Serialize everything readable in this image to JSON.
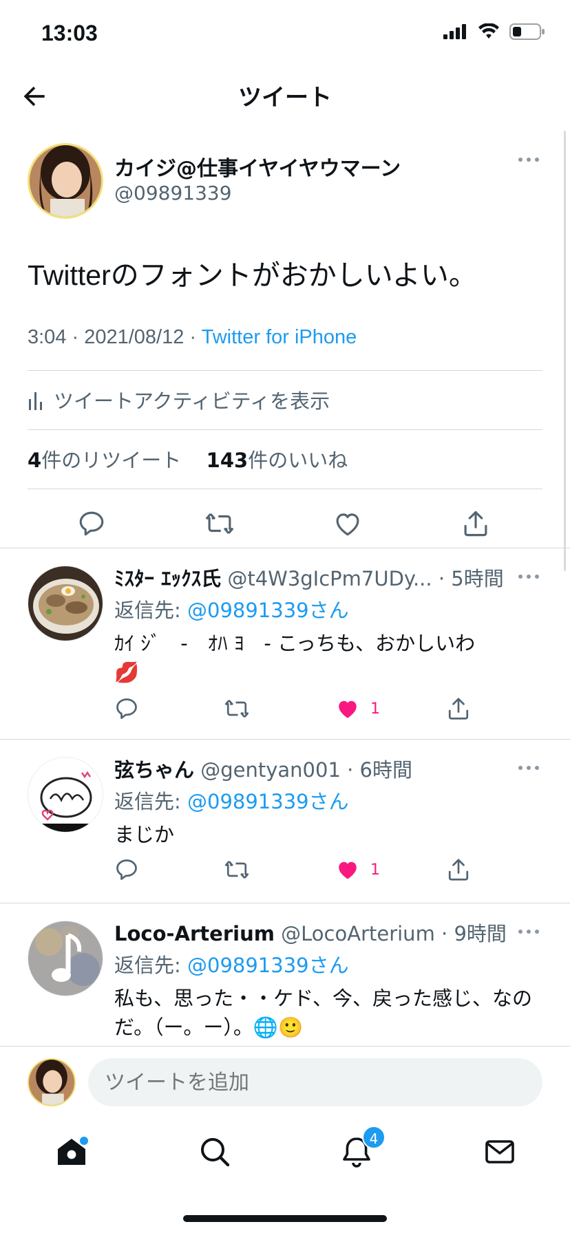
{
  "status_bar": {
    "time": "13:03"
  },
  "nav": {
    "title": "ツイート"
  },
  "main_tweet": {
    "author_name": "カイジ@仕事イヤイヤウマーン",
    "author_handle": "@09891339",
    "text": "Twitterのフォントがおかしいよい。",
    "time_date": "3:04 · 2021/08/12 · ",
    "source": "Twitter for iPhone",
    "activity_label": "ツイートアクティビティを表示",
    "retweet_count": "4",
    "retweet_label": "件のリツイート",
    "like_count": "143",
    "like_label": "件のいいね"
  },
  "replies": [
    {
      "name": "ﾐｽﾀｰ ｴｯｸｽ氏",
      "meta": " @t4W3gIcPm7UDy... · 5時間",
      "replyto_label": "返信先: ",
      "replyto_mention": "@09891339さん",
      "body": "ｶｲ ｼﾞ　-　ｵﾊ ﾖ　- こっちも、おかしいわ",
      "body_emoji": "💋",
      "like_count": "1"
    },
    {
      "name": "弦ちゃん",
      "meta": " @gentyan001 · 6時間",
      "replyto_label": "返信先: ",
      "replyto_mention": "@09891339さん",
      "body": "まじか",
      "body_emoji": "",
      "like_count": "1"
    },
    {
      "name": "Loco-Arterium",
      "meta": " @LocoArterium · 9時間",
      "replyto_label": "返信先: ",
      "replyto_mention": "@09891339さん",
      "body": "私も、思った・・ケド、今、戻った感じ、なのだ。（ー。ー）。",
      "body_emoji": "🌐🙂",
      "like_count": ""
    }
  ],
  "composer": {
    "placeholder": "ツイートを追加"
  },
  "tabbar": {
    "notifications_badge": "4"
  },
  "colors": {
    "accent": "#1d9bf0",
    "like": "#f91880",
    "muted": "#536471",
    "divider": "#cfd9de"
  }
}
